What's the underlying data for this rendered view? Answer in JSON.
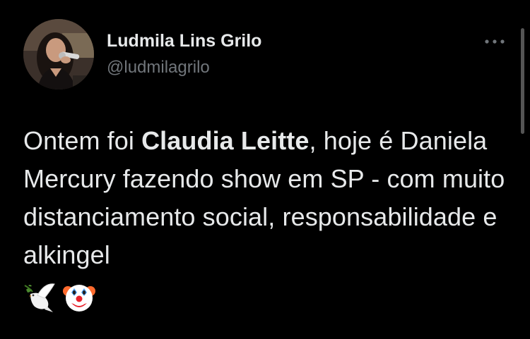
{
  "author": {
    "name": "Ludmila Lins Grilo",
    "handle": "@ludmilagrilo"
  },
  "more_icon": "more-horizontal-icon",
  "tweet": {
    "text_before": "Ontem foi ",
    "text_bold": "Claudia Leitte",
    "text_after": ", hoje é Daniela Mercury fazendo show em SP - com muito distanciamento social, responsabilidade e alkingel",
    "emojis": [
      "dove-icon",
      "clown-face-icon"
    ]
  },
  "colors": {
    "background": "#000000",
    "primary_text": "#e7e9ea",
    "secondary_text": "#71767b"
  }
}
